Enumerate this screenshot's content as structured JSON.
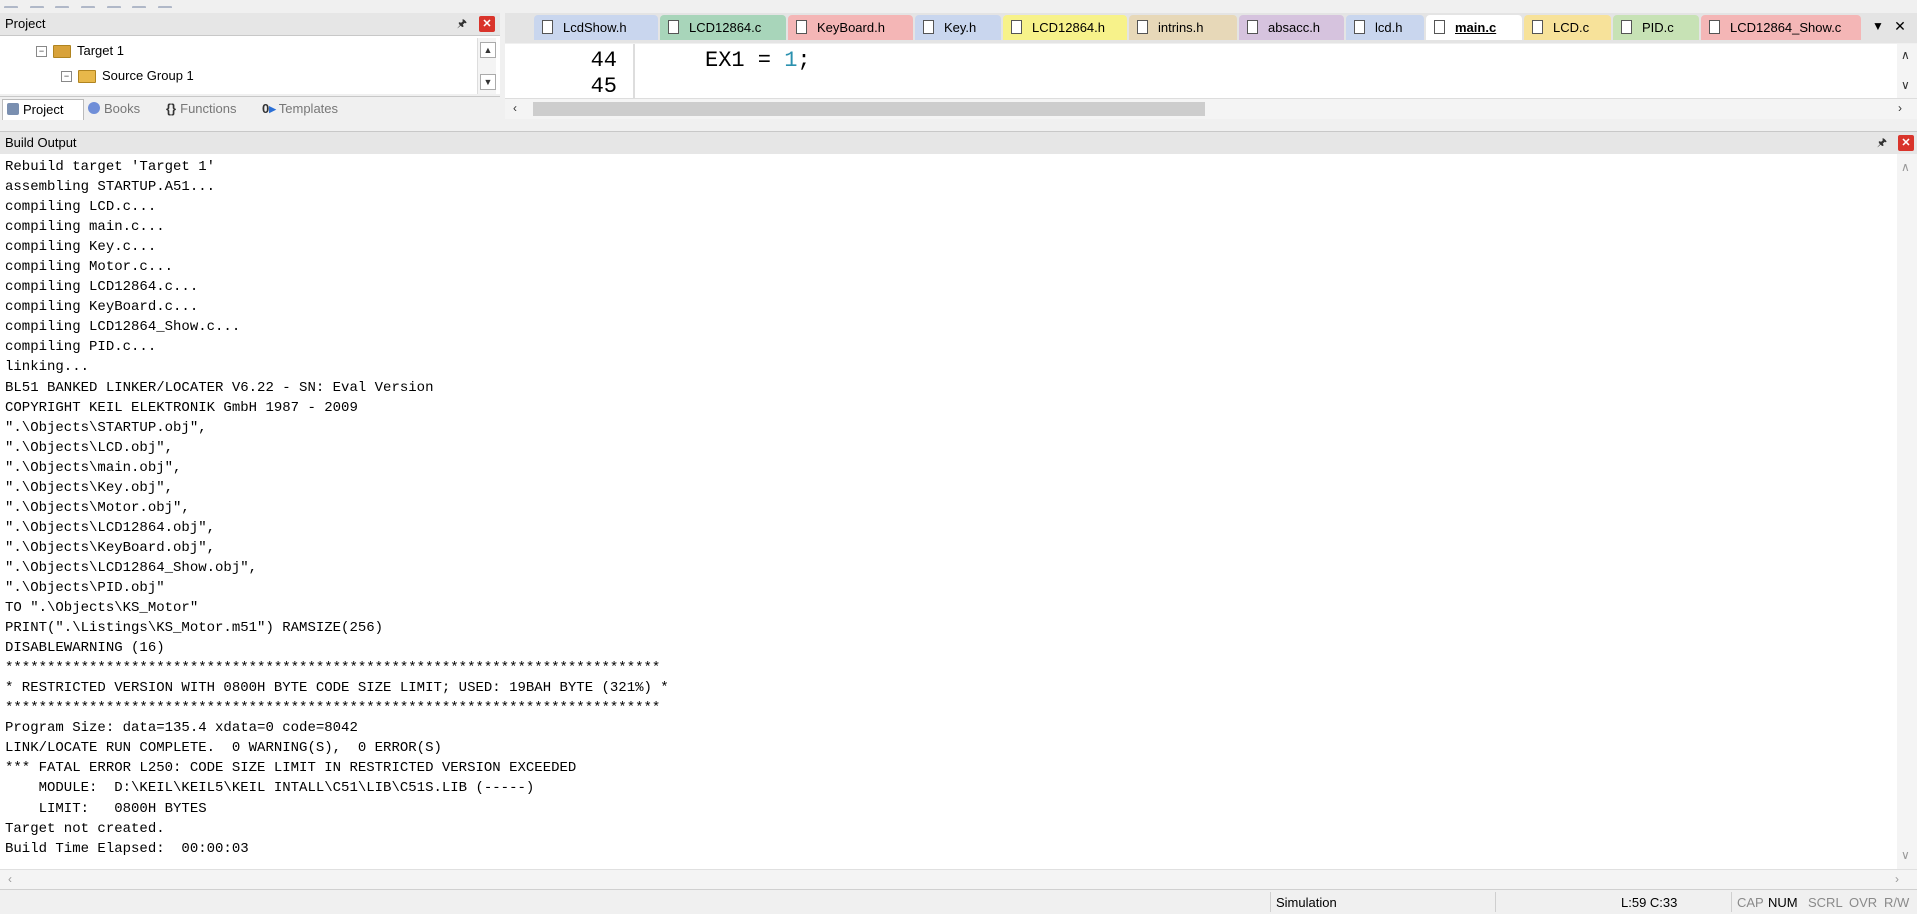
{
  "project_pane": {
    "title": "Project",
    "tree": [
      {
        "label": "Target 1"
      },
      {
        "label": "Source Group 1"
      }
    ],
    "tabs": [
      {
        "label": "Project",
        "icon": "project-icon"
      },
      {
        "label": "Books",
        "icon": "books-icon"
      },
      {
        "label": "Functions",
        "icon": "functions-icon"
      },
      {
        "label": "Templates",
        "icon": "templates-icon"
      }
    ]
  },
  "editor": {
    "tabs": [
      {
        "label": "LcdShow.h",
        "color": "#c9d6ee"
      },
      {
        "label": "LCD12864.c",
        "color": "#a8d5ba"
      },
      {
        "label": "KeyBoard.h",
        "color": "#f4b6b6"
      },
      {
        "label": "Key.h",
        "color": "#c9d6ee"
      },
      {
        "label": "LCD12864.h",
        "color": "#f7f28a"
      },
      {
        "label": "intrins.h",
        "color": "#e7d8b8"
      },
      {
        "label": "absacc.h",
        "color": "#d6c3de"
      },
      {
        "label": "lcd.h",
        "color": "#c9d6ee"
      },
      {
        "label": "main.c",
        "color": "#ffffff",
        "active": true
      },
      {
        "label": "LCD.c",
        "color": "#f7e29a"
      },
      {
        "label": "PID.c",
        "color": "#c7e2b5"
      },
      {
        "label": "LCD12864_Show.c",
        "color": "#f4b6b6"
      }
    ],
    "lines": [
      {
        "num": "44",
        "text": "EX1 = ",
        "value": "1",
        "end": ";"
      },
      {
        "num": "45",
        "text": "",
        "value": "",
        "end": ""
      }
    ]
  },
  "build_output": {
    "title": "Build Output",
    "lines": [
      "Rebuild target 'Target 1'",
      "assembling STARTUP.A51...",
      "compiling LCD.c...",
      "compiling main.c...",
      "compiling Key.c...",
      "compiling Motor.c...",
      "compiling LCD12864.c...",
      "compiling KeyBoard.c...",
      "compiling LCD12864_Show.c...",
      "compiling PID.c...",
      "linking...",
      "BL51 BANKED LINKER/LOCATER V6.22 - SN: Eval Version",
      "COPYRIGHT KEIL ELEKTRONIK GmbH 1987 - 2009",
      "\".\\Objects\\STARTUP.obj\",",
      "\".\\Objects\\LCD.obj\",",
      "\".\\Objects\\main.obj\",",
      "\".\\Objects\\Key.obj\",",
      "\".\\Objects\\Motor.obj\",",
      "\".\\Objects\\LCD12864.obj\",",
      "\".\\Objects\\KeyBoard.obj\",",
      "\".\\Objects\\LCD12864_Show.obj\",",
      "\".\\Objects\\PID.obj\"",
      "TO \".\\Objects\\KS_Motor\"",
      "PRINT(\".\\Listings\\KS_Motor.m51\") RAMSIZE(256)",
      "DISABLEWARNING (16)",
      "******************************************************************************",
      "* RESTRICTED VERSION WITH 0800H BYTE CODE SIZE LIMIT; USED: 19BAH BYTE (321%) *",
      "******************************************************************************",
      "Program Size: data=135.4 xdata=0 code=8042",
      "LINK/LOCATE RUN COMPLETE.  0 WARNING(S),  0 ERROR(S)",
      "*** FATAL ERROR L250: CODE SIZE LIMIT IN RESTRICTED VERSION EXCEEDED",
      "    MODULE:  D:\\KEIL\\KEIL5\\KEIL INTALL\\C51\\LIB\\C51S.LIB (-----)",
      "    LIMIT:   0800H BYTES",
      "Target not created.",
      "Build Time Elapsed:  00:00:03"
    ]
  },
  "status_bar": {
    "mode": "Simulation",
    "position": "L:59 C:33",
    "caps": "CAP",
    "num": "NUM",
    "scrl": "SCRL",
    "ovr": "OVR",
    "rw": "R/W"
  }
}
